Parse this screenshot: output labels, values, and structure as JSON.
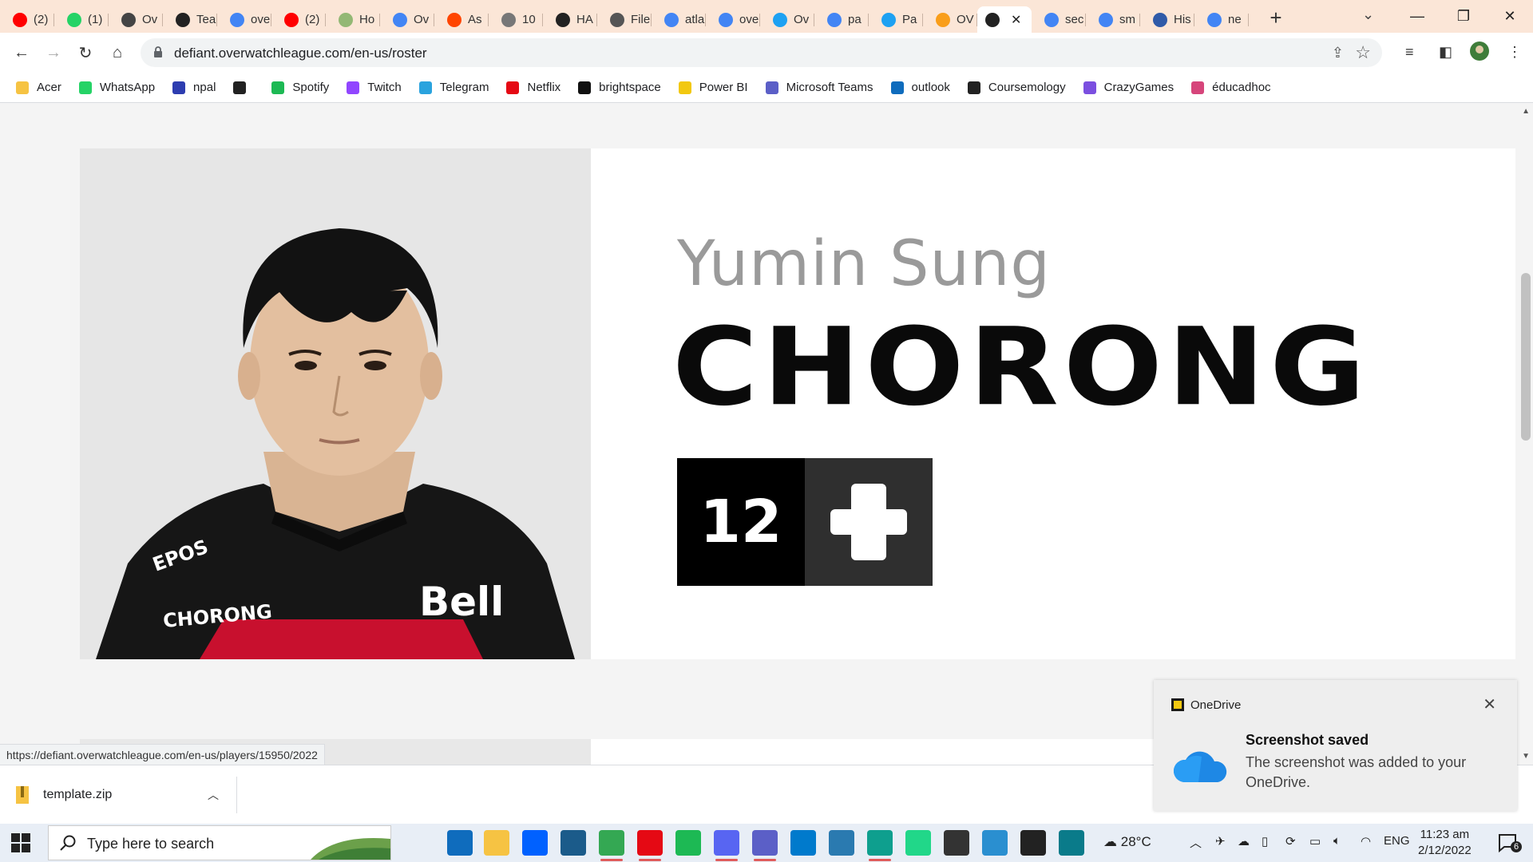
{
  "browser": {
    "tabs": [
      {
        "label": "(2)",
        "icon": "youtube-icon",
        "color": "#ff0000"
      },
      {
        "label": "(1)",
        "icon": "whatsapp-icon",
        "color": "#25d366"
      },
      {
        "label": "Ov",
        "icon": "overwatch-icon",
        "color": "#444444"
      },
      {
        "label": "Tea",
        "icon": "owl-team-icon",
        "color": "#222222"
      },
      {
        "label": "ove",
        "icon": "google-icon",
        "color": "#4285f4"
      },
      {
        "label": "(2)",
        "icon": "youtube-icon",
        "color": "#ff0000"
      },
      {
        "label": "Ho",
        "icon": "wikihow-icon",
        "color": "#93b874"
      },
      {
        "label": "Ov",
        "icon": "google-icon",
        "color": "#4285f4"
      },
      {
        "label": "As",
        "icon": "reddit-icon",
        "color": "#ff4500"
      },
      {
        "label": "10",
        "icon": "globe-icon",
        "color": "#777777"
      },
      {
        "label": "HA",
        "icon": "owl-team-icon",
        "color": "#222222"
      },
      {
        "label": "File",
        "icon": "fandom-icon",
        "color": "#555555"
      },
      {
        "label": "atla",
        "icon": "google-icon",
        "color": "#4285f4"
      },
      {
        "label": "ove",
        "icon": "google-icon",
        "color": "#4285f4"
      },
      {
        "label": "Ov",
        "icon": "twitter-icon",
        "color": "#1da1f2"
      },
      {
        "label": "pa",
        "icon": "google-icon",
        "color": "#4285f4"
      },
      {
        "label": "Pa",
        "icon": "twitter-icon",
        "color": "#1da1f2"
      },
      {
        "label": "OV",
        "icon": "owl-icon",
        "color": "#f99e1a"
      },
      {
        "label": "",
        "icon": "owl-team-icon",
        "color": "#222222",
        "active": true
      },
      {
        "label": "sec",
        "icon": "google-icon",
        "color": "#4285f4"
      },
      {
        "label": "sm",
        "icon": "google-icon",
        "color": "#4285f4"
      },
      {
        "label": "His",
        "icon": "globe-icon",
        "color": "#2f5aa8"
      },
      {
        "label": "ne",
        "icon": "google-icon",
        "color": "#4285f4"
      }
    ],
    "url": "defiant.overwatchleague.com/en-us/roster",
    "bookmarks": [
      {
        "label": "Acer",
        "icon": "folder-icon",
        "color": "#f6c343"
      },
      {
        "label": "WhatsApp",
        "icon": "whatsapp-icon",
        "color": "#25d366"
      },
      {
        "label": "npal",
        "icon": "npal-icon",
        "color": "#2d3db0"
      },
      {
        "label": "",
        "icon": "globe-icon",
        "color": "#222222"
      },
      {
        "label": "Spotify",
        "icon": "spotify-icon",
        "color": "#1db954"
      },
      {
        "label": "Twitch",
        "icon": "twitch-icon",
        "color": "#9146ff"
      },
      {
        "label": "Telegram",
        "icon": "telegram-icon",
        "color": "#2aa3de"
      },
      {
        "label": "Netflix",
        "icon": "netflix-icon",
        "color": "#e50914"
      },
      {
        "label": "brightspace",
        "icon": "np-icon",
        "color": "#111111"
      },
      {
        "label": "Power BI",
        "icon": "powerbi-icon",
        "color": "#f2c811"
      },
      {
        "label": "Microsoft Teams",
        "icon": "teams-icon",
        "color": "#5b5fc7"
      },
      {
        "label": "outlook",
        "icon": "outlook-icon",
        "color": "#0f6cbd"
      },
      {
        "label": "Coursemology",
        "icon": "coursemology-icon",
        "color": "#222222"
      },
      {
        "label": "CrazyGames",
        "icon": "crazygames-icon",
        "color": "#7b4fe0"
      },
      {
        "label": "éducadhoc",
        "icon": "educadhoc-icon",
        "color": "#d6457b"
      }
    ],
    "status_url": "https://defiant.overwatchleague.com/en-us/players/15950/2022"
  },
  "player": {
    "real_name": "Yumin Sung",
    "gamer_tag": "CHORONG",
    "number": "12",
    "role_icon": "support-cross-icon",
    "jersey_sponsor_epos": "EPOS",
    "jersey_name": "CHORONG",
    "jersey_sponsor_bell": "Bell"
  },
  "downloads": {
    "file_name": "template.zip"
  },
  "toast": {
    "app": "OneDrive",
    "title": "Screenshot saved",
    "body": "The screenshot was added to your OneDrive."
  },
  "taskbar": {
    "search_placeholder": "Type here to search",
    "temperature": "28°C",
    "language": "ENG",
    "time": "11:23 am",
    "date": "2/12/2022",
    "notification_count": "6"
  },
  "colors": {
    "tabstrip": "#fbe6d7",
    "number_bg": "#000000",
    "role_bg": "#2f2f2f",
    "real_name": "#9a9a9a"
  }
}
